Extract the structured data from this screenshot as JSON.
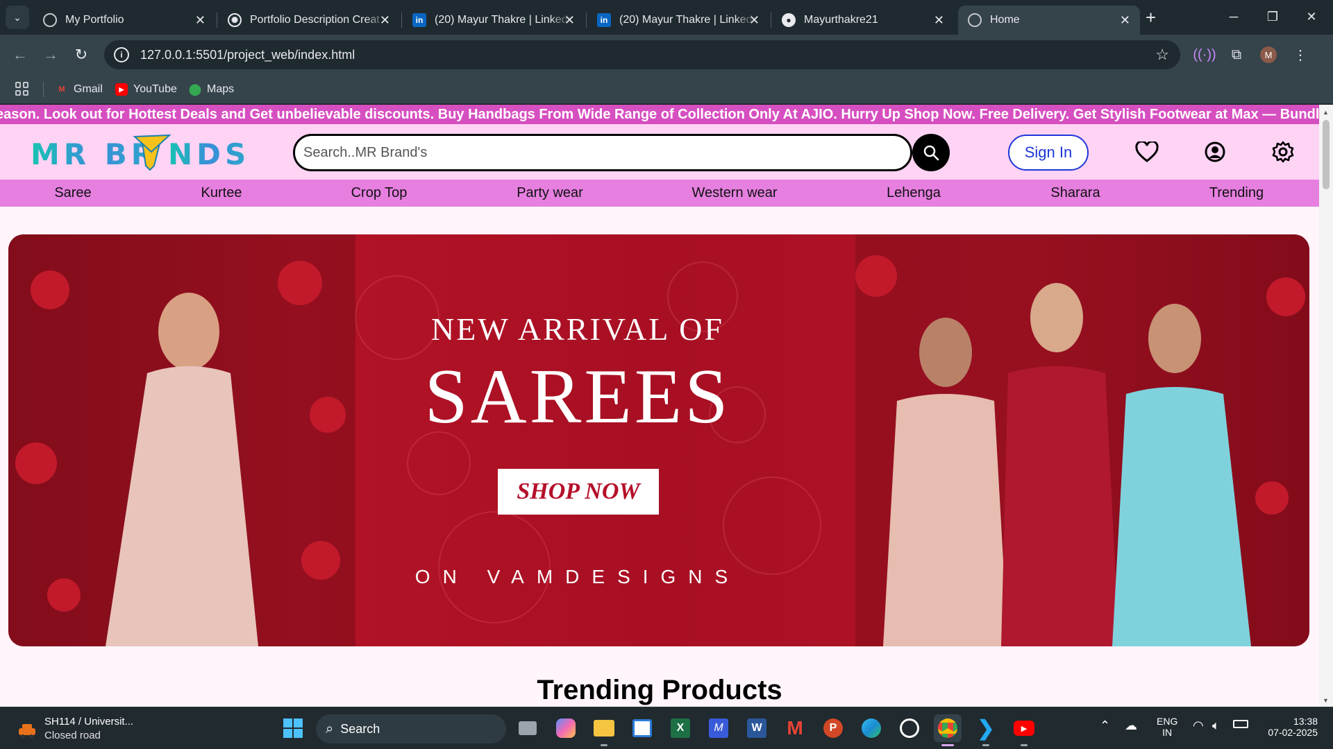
{
  "browser": {
    "tabs": [
      {
        "title": "My Portfolio",
        "icon": "globe-icon",
        "active": false
      },
      {
        "title": "Portfolio Description Creat",
        "icon": "chatgpt-icon",
        "active": false
      },
      {
        "title": "(20) Mayur Thakre | LinkedI",
        "icon": "linkedin-icon",
        "active": false
      },
      {
        "title": "(20) Mayur Thakre | LinkedI",
        "icon": "linkedin-icon",
        "active": false
      },
      {
        "title": "Mayurthakre21",
        "icon": "github-icon",
        "active": false
      },
      {
        "title": "Home",
        "icon": "globe-icon",
        "active": true
      }
    ],
    "url": "127.0.0.1:5501/project_web/index.html",
    "profile_initial": "M",
    "bookmarks": [
      {
        "label": "Gmail",
        "icon": "gmail-icon"
      },
      {
        "label": "YouTube",
        "icon": "youtube-icon"
      },
      {
        "label": "Maps",
        "icon": "maps-icon"
      }
    ]
  },
  "site": {
    "marquee": "eason. Look out for Hottest Deals and Get unbelievable discounts. Buy Handbags From Wide Range of Collection Only At AJIO. Hurry Up Shop Now. Free Delivery. Get Stylish Footwear at Max — Bundle & Save Big",
    "logo_text": "MR BRANDS",
    "search_placeholder": "Search..MR Brand's",
    "signin_label": "Sign In",
    "categories": [
      "Saree",
      "Kurtee",
      "Crop Top",
      "Party wear",
      "Western wear",
      "Lehenga",
      "Sharara",
      "Trending"
    ],
    "banner": {
      "line1": "NEW ARRIVAL OF",
      "line2": "SAREES",
      "cta": "SHOP NOW",
      "footer": "ON VAMDESIGNS"
    },
    "section_title": "Trending Products"
  },
  "taskbar": {
    "weather_title": "SH114 / Universit...",
    "weather_sub": "Closed road",
    "search_label": "Search",
    "lang_top": "ENG",
    "lang_bottom": "IN",
    "time": "13:38",
    "date": "07-02-2025"
  },
  "colors": {
    "marquee_bg": "#d64fc0",
    "header_bg": "#ffd3f4",
    "nav_bg": "#e67fe0",
    "signin": "#1d37d8",
    "banner_red": "#a80f23"
  }
}
